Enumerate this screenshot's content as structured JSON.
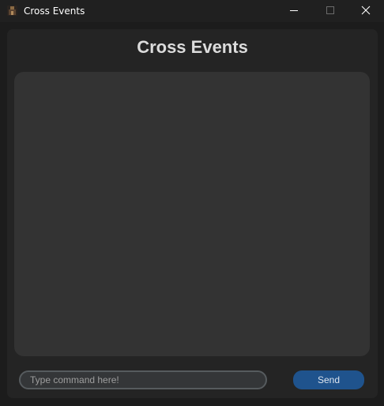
{
  "window": {
    "title": "Cross Events",
    "app_icon": "app-icon",
    "controls": {
      "minimize_icon": "minimize-icon",
      "maximize_icon": "maximize-icon",
      "close_icon": "close-icon"
    }
  },
  "main": {
    "heading": "Cross Events",
    "output_text": "",
    "command_input": {
      "value": "",
      "placeholder": "Type command here!"
    },
    "send_label": "Send"
  },
  "colors": {
    "titlebar_bg": "#202020",
    "window_bg": "#1c1c1c",
    "panel_bg": "#242424",
    "output_bg": "#333333",
    "input_bg": "#343638",
    "input_border": "#565b5e",
    "accent": "#1f538d"
  }
}
